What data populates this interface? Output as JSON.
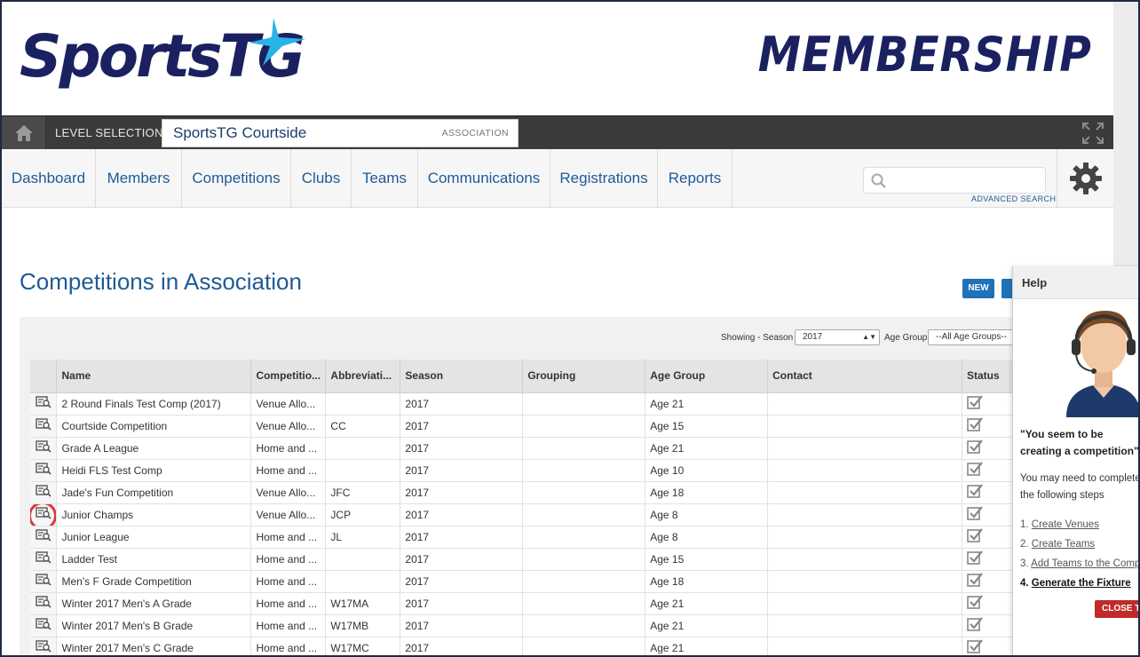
{
  "brand": {
    "logo_text": "SportsTG",
    "product": "MEMBERSHIP"
  },
  "level_bar": {
    "label": "LEVEL SELECTION",
    "value": "SportsTG Courtside",
    "type": "ASSOCIATION"
  },
  "nav": {
    "items": [
      {
        "label": "Dashboard"
      },
      {
        "label": "Members"
      },
      {
        "label": "Competitions"
      },
      {
        "label": "Clubs"
      },
      {
        "label": "Teams"
      },
      {
        "label": "Communications"
      },
      {
        "label": "Registrations"
      },
      {
        "label": "Reports"
      }
    ],
    "search_placeholder": "",
    "advanced_search": "ADVANCED SEARCH"
  },
  "page": {
    "title": "Competitions in Association",
    "new_label": "NEW"
  },
  "filters": {
    "season_label": "Showing - Season",
    "season_value": "2017",
    "age_label": "Age Group",
    "age_value": "--All Age Groups--"
  },
  "table": {
    "columns": [
      "Name",
      "Competitio...",
      "Abbreviati...",
      "Season",
      "Grouping",
      "Age Group",
      "Contact",
      "Status"
    ],
    "rows": [
      {
        "name": "2 Round Finals Test Comp (2017)",
        "type": "Venue Allo...",
        "abbr": "",
        "season": "2017",
        "grouping": "",
        "age": "Age 21",
        "contact": ""
      },
      {
        "name": "Courtside Competition",
        "type": "Venue Allo...",
        "abbr": "CC",
        "season": "2017",
        "grouping": "",
        "age": "Age 15",
        "contact": ""
      },
      {
        "name": "Grade A League",
        "type": "Home and ...",
        "abbr": "",
        "season": "2017",
        "grouping": "",
        "age": "Age 21",
        "contact": ""
      },
      {
        "name": "Heidi FLS Test Comp",
        "type": "Home and ...",
        "abbr": "",
        "season": "2017",
        "grouping": "",
        "age": "Age 10",
        "contact": ""
      },
      {
        "name": "Jade's Fun Competition",
        "type": "Venue Allo...",
        "abbr": "JFC",
        "season": "2017",
        "grouping": "",
        "age": "Age 18",
        "contact": ""
      },
      {
        "name": "Junior Champs",
        "type": "Venue Allo...",
        "abbr": "JCP",
        "season": "2017",
        "grouping": "",
        "age": "Age 8",
        "contact": ""
      },
      {
        "name": "Junior League",
        "type": "Home and ...",
        "abbr": "JL",
        "season": "2017",
        "grouping": "",
        "age": "Age 8",
        "contact": ""
      },
      {
        "name": "Ladder Test",
        "type": "Home and ...",
        "abbr": "",
        "season": "2017",
        "grouping": "",
        "age": "Age 15",
        "contact": ""
      },
      {
        "name": "Men's F Grade Competition",
        "type": "Home and ...",
        "abbr": "",
        "season": "2017",
        "grouping": "",
        "age": "Age 18",
        "contact": ""
      },
      {
        "name": "Winter 2017 Men's A Grade",
        "type": "Home and ...",
        "abbr": "W17MA",
        "season": "2017",
        "grouping": "",
        "age": "Age 21",
        "contact": ""
      },
      {
        "name": "Winter 2017 Men's B Grade",
        "type": "Home and ...",
        "abbr": "W17MB",
        "season": "2017",
        "grouping": "",
        "age": "Age 21",
        "contact": ""
      },
      {
        "name": "Winter 2017 Men's C Grade",
        "type": "Home and ...",
        "abbr": "W17MC",
        "season": "2017",
        "grouping": "",
        "age": "Age 21",
        "contact": ""
      }
    ]
  },
  "help": {
    "title": "Help",
    "quote": "\"You seem to be creating a competition\"",
    "text": "You may need to complete the following steps",
    "steps": [
      {
        "num": "1.",
        "label": "Create Venues"
      },
      {
        "num": "2.",
        "label": "Create Teams"
      },
      {
        "num": "3.",
        "label": "Add Teams to the Competition"
      },
      {
        "num": "4.",
        "label": "Generate the Fixture"
      }
    ],
    "close_label": "CLOSE THIS"
  },
  "colors": {
    "brand_navy": "#1b2160",
    "link_blue": "#1f5a96",
    "button_blue": "#1f72b8",
    "highlight_red": "#d9373d"
  }
}
